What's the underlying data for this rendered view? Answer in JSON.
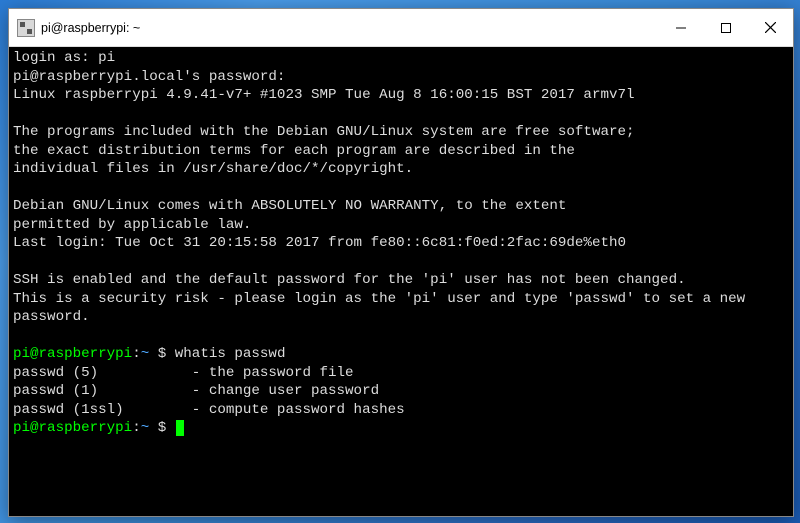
{
  "titlebar": {
    "icon": "putty-icon",
    "title": "pi@raspberrypi: ~"
  },
  "terminal": {
    "login_prompt": "login as: pi",
    "password_prompt": "pi@raspberrypi.local's password:",
    "kernel": "Linux raspberrypi 4.9.41-v7+ #1023 SMP Tue Aug 8 16:00:15 BST 2017 armv7l",
    "motd1": "The programs included with the Debian GNU/Linux system are free software;",
    "motd2": "the exact distribution terms for each program are described in the",
    "motd3": "individual files in /usr/share/doc/*/copyright.",
    "warranty1": "Debian GNU/Linux comes with ABSOLUTELY NO WARRANTY, to the extent",
    "warranty2": "permitted by applicable law.",
    "last_login": "Last login: Tue Oct 31 20:15:58 2017 from fe80::6c81:f0ed:2fac:69de%eth0",
    "ssh_warn1": "SSH is enabled and the default password for the 'pi' user has not been changed.",
    "ssh_warn2": "This is a security risk - please login as the 'pi' user and type 'passwd' to set a new password.",
    "prompt_user": "pi@raspberrypi",
    "prompt_sep": ":",
    "prompt_path": "~",
    "prompt_dollar": " $ ",
    "command": "whatis passwd",
    "whatis": [
      {
        "name": "passwd (5)",
        "desc": "- the password file"
      },
      {
        "name": "passwd (1)",
        "desc": "- change user password"
      },
      {
        "name": "passwd (1ssl)",
        "desc": "- compute password hashes"
      }
    ]
  }
}
